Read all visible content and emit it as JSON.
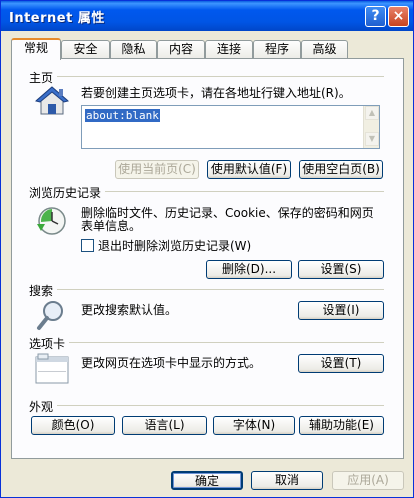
{
  "window": {
    "title": "Internet 属性",
    "help_label": "?",
    "close_label": "×"
  },
  "tabs": [
    {
      "label": "常规",
      "active": true
    },
    {
      "label": "安全"
    },
    {
      "label": "隐私"
    },
    {
      "label": "内容"
    },
    {
      "label": "连接"
    },
    {
      "label": "程序"
    },
    {
      "label": "高级"
    }
  ],
  "homepage": {
    "section_title": "主页",
    "description": "若要创建主页选项卡，请在各地址行键入地址(R)。",
    "value": "about:blank",
    "btn_current": "使用当前页(C)",
    "btn_default": "使用默认值(F)",
    "btn_blank": "使用空白页(B)"
  },
  "history": {
    "section_title": "浏览历史记录",
    "description_line1": "删除临时文件、历史记录、Cookie、保存的密码和网页",
    "description_line2": "表单信息。",
    "checkbox_label": "退出时删除浏览历史记录(W)",
    "btn_delete": "删除(D)...",
    "btn_settings": "设置(S)"
  },
  "search": {
    "section_title": "搜索",
    "description": "更改搜索默认值。",
    "btn_settings": "设置(I)"
  },
  "tabs_section": {
    "section_title": "选项卡",
    "description": "更改网页在选项卡中显示的方式。",
    "btn_settings": "设置(T)"
  },
  "appearance": {
    "section_title": "外观",
    "btn_colors": "颜色(O)",
    "btn_languages": "语言(L)",
    "btn_fonts": "字体(N)",
    "btn_accessibility": "辅助功能(E)"
  },
  "footer": {
    "btn_ok": "确定",
    "btn_cancel": "取消",
    "btn_apply": "应用(A)"
  }
}
